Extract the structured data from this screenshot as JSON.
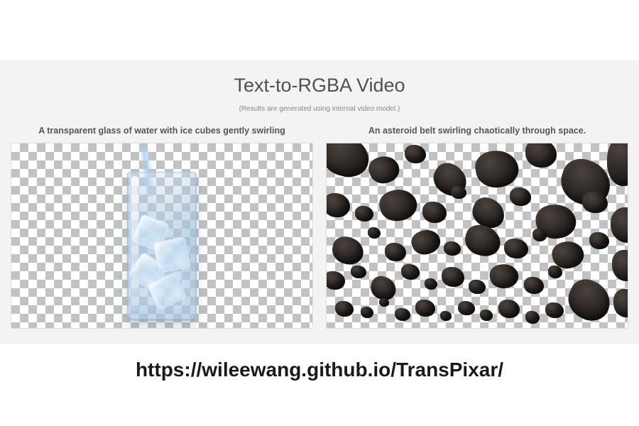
{
  "section": {
    "title": "Text-to-RGBA Video",
    "subtitle": "(Results are generated using internal video model.)"
  },
  "examples": [
    {
      "caption": "A transparent glass of water with ice cubes gently swirling"
    },
    {
      "caption": "An asteroid belt swirling chaotically through space."
    }
  ],
  "footer": {
    "url": "https://wileewang.github.io/TransPixar/"
  }
}
